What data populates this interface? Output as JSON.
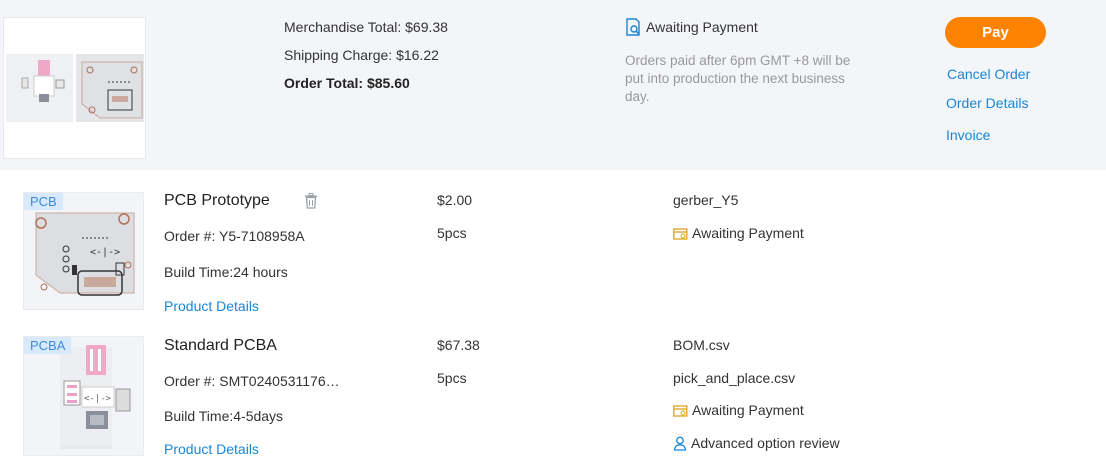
{
  "summary": {
    "merchandise_total": "Merchandise Total: $69.38",
    "shipping_charge": "Shipping Charge: $16.22",
    "order_total": "Order Total: $85.60",
    "status": "Awaiting Payment",
    "note": "Orders paid after 6pm GMT +8 will be put into production the next business day.",
    "pay_label": "Pay",
    "cancel_label": "Cancel Order",
    "details_label": "Order Details",
    "invoice_label": "Invoice"
  },
  "items": [
    {
      "tag": "PCB",
      "name": "PCB Prototype",
      "order_no": "Order #:  Y5-7108958A",
      "build_time": "Build Time:24 hours",
      "details_link": "Product Details",
      "price": "$2.00",
      "qty": "5pcs",
      "files": [
        "gerber_Y5"
      ],
      "status": "Awaiting Payment"
    },
    {
      "tag": "PCBA",
      "name": "Standard PCBA",
      "order_no": "Order #:  SMT0240531176…",
      "build_time": "Build Time:4-5days",
      "details_link": "Product Details",
      "price": "$67.38",
      "qty": "5pcs",
      "files": [
        "BOM.csv",
        "pick_and_place.csv"
      ],
      "status": "Awaiting Payment",
      "review": "Advanced option review"
    }
  ],
  "colors": {
    "accent_orange": "#ff8200",
    "link_blue": "#1a86d6",
    "summary_bg": "#f3f5f8",
    "note_gray": "#999999"
  },
  "icons": {
    "summary_status": "search-document-icon",
    "item_status": "payment-card-icon",
    "review": "user-review-icon",
    "delete": "trash-icon"
  }
}
